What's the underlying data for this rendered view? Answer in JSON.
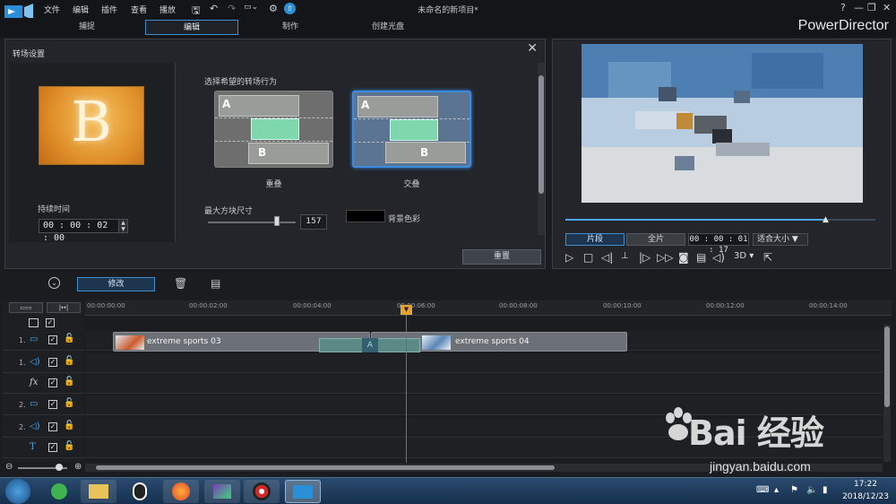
{
  "menu": {
    "file": "文件",
    "edit": "编辑",
    "plugins": "插件",
    "view": "查看",
    "playback": "播放",
    "project_title": "未命名的新项目*"
  },
  "window_controls": {
    "help": "?",
    "minimize": "—",
    "restore": "❐",
    "close": "✕"
  },
  "modes": {
    "capture": "捕捉",
    "edit": "编辑",
    "produce": "制作",
    "create_disc": "创建光盘",
    "brand": "PowerDirector"
  },
  "transition_panel": {
    "title": "转场设置",
    "thumb_letter": "B",
    "duration_label": "持续时间",
    "duration_value": "00 : 00 : 02 : 00",
    "behavior_label": "选择希望的转场行为",
    "option_overlap": {
      "label": "重叠",
      "a": "A",
      "b": "B"
    },
    "option_cross": {
      "label": "交叠",
      "a": "A",
      "b": "B"
    },
    "selected_option": "交叠",
    "max_block_label": "最大方块尺寸",
    "max_block_value": "157",
    "bg_color_label": "背景色彩",
    "bg_color": "#000000",
    "reset_label": "重置"
  },
  "preview": {
    "progress": 0.84,
    "segment_label": "片段",
    "full_label": "全片",
    "timecode": "00 : 00 : 01 : 17",
    "fit_label": "适合大小",
    "mode_3d": "3D"
  },
  "toolbar": {
    "modify_label": "修改"
  },
  "timeline": {
    "ticks": [
      "00:00:00:00",
      "00:00:02:00",
      "00:00:04:00",
      "00:00:06:00",
      "00:00:08:00",
      "00:00:10:00",
      "00:00:12:00",
      "00:00:14:00"
    ],
    "playhead_time": "00:00:06:00",
    "tracks": [
      {
        "num": "1.",
        "icon": "video-track-icon"
      },
      {
        "num": "1.",
        "icon": "audio-track-icon"
      },
      {
        "num": "",
        "icon": "fx-track-icon",
        "glyph": "fx"
      },
      {
        "num": "2.",
        "icon": "video-track-icon"
      },
      {
        "num": "2.",
        "icon": "audio-track-icon"
      },
      {
        "num": "",
        "icon": "title-track-icon",
        "glyph": "T"
      }
    ],
    "clips": {
      "clip1": "extreme sports 03",
      "clip2": "extreme sports 04",
      "transition_mark": "A"
    }
  },
  "watermark": {
    "main": "Bai 经验",
    "url": "jingyan.baidu.com"
  },
  "taskbar": {
    "time": "17:22",
    "date": "2018/12/23"
  },
  "colors": {
    "accent": "#3f8fd0",
    "playhead": "#e04040",
    "selection_green": "#7fd7ad"
  }
}
